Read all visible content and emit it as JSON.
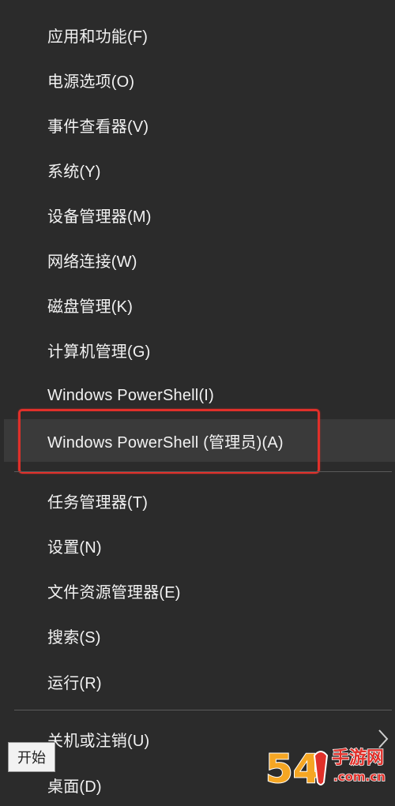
{
  "menu": {
    "items": [
      {
        "label": "应用和功能(F)"
      },
      {
        "label": "电源选项(O)"
      },
      {
        "label": "事件查看器(V)"
      },
      {
        "label": "系统(Y)"
      },
      {
        "label": "设备管理器(M)"
      },
      {
        "label": "网络连接(W)"
      },
      {
        "label": "磁盘管理(K)"
      },
      {
        "label": "计算机管理(G)"
      },
      {
        "label": "Windows PowerShell(I)"
      },
      {
        "label": "Windows PowerShell (管理员)(A)"
      },
      {
        "label": "任务管理器(T)"
      },
      {
        "label": "设置(N)"
      },
      {
        "label": "文件资源管理器(E)"
      },
      {
        "label": "搜索(S)"
      },
      {
        "label": "运行(R)"
      },
      {
        "label": "关机或注销(U)"
      },
      {
        "label": "桌面(D)"
      }
    ]
  },
  "tooltip": {
    "text": "开始"
  },
  "watermark": {
    "text": "54 手游网 .com.cn"
  },
  "colors": {
    "background": "#2b2b2b",
    "hover": "#3a3a3a",
    "highlight_border": "#e0302a",
    "text": "#f2f2f2",
    "divider": "#5a5a5a"
  },
  "icons": {
    "submenu": "chevron-right-icon"
  }
}
